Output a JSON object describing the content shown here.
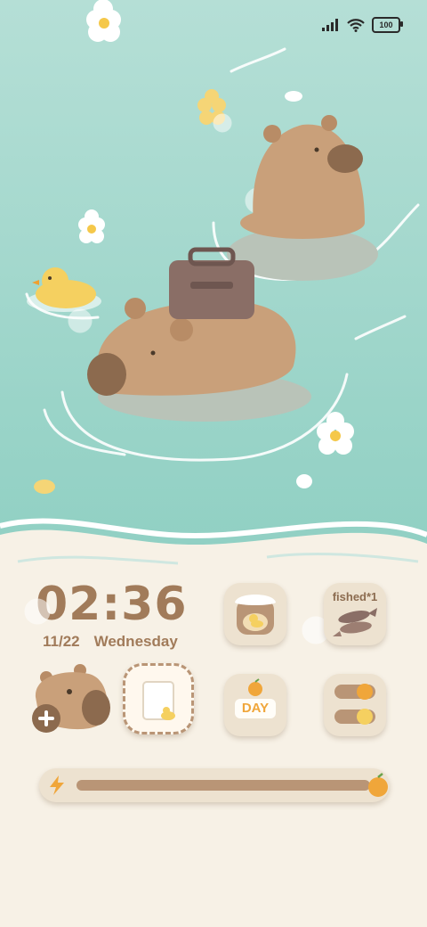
{
  "status_bar": {
    "battery": "100"
  },
  "clock_widget": {
    "time": "02:36",
    "date": "11/22",
    "weekday": "Wednesday"
  },
  "apps": {
    "fishing_label": "fished*1",
    "day_label": "DAY"
  },
  "colors": {
    "water": "#9fd6cb",
    "sand": "#f7f1e6",
    "capybara": "#c9a07a",
    "accent_text": "#a17b5a"
  },
  "icons": [
    "signal-icon",
    "wifi-icon",
    "battery-icon",
    "plus-icon",
    "lightning-icon",
    "orange-icon"
  ]
}
